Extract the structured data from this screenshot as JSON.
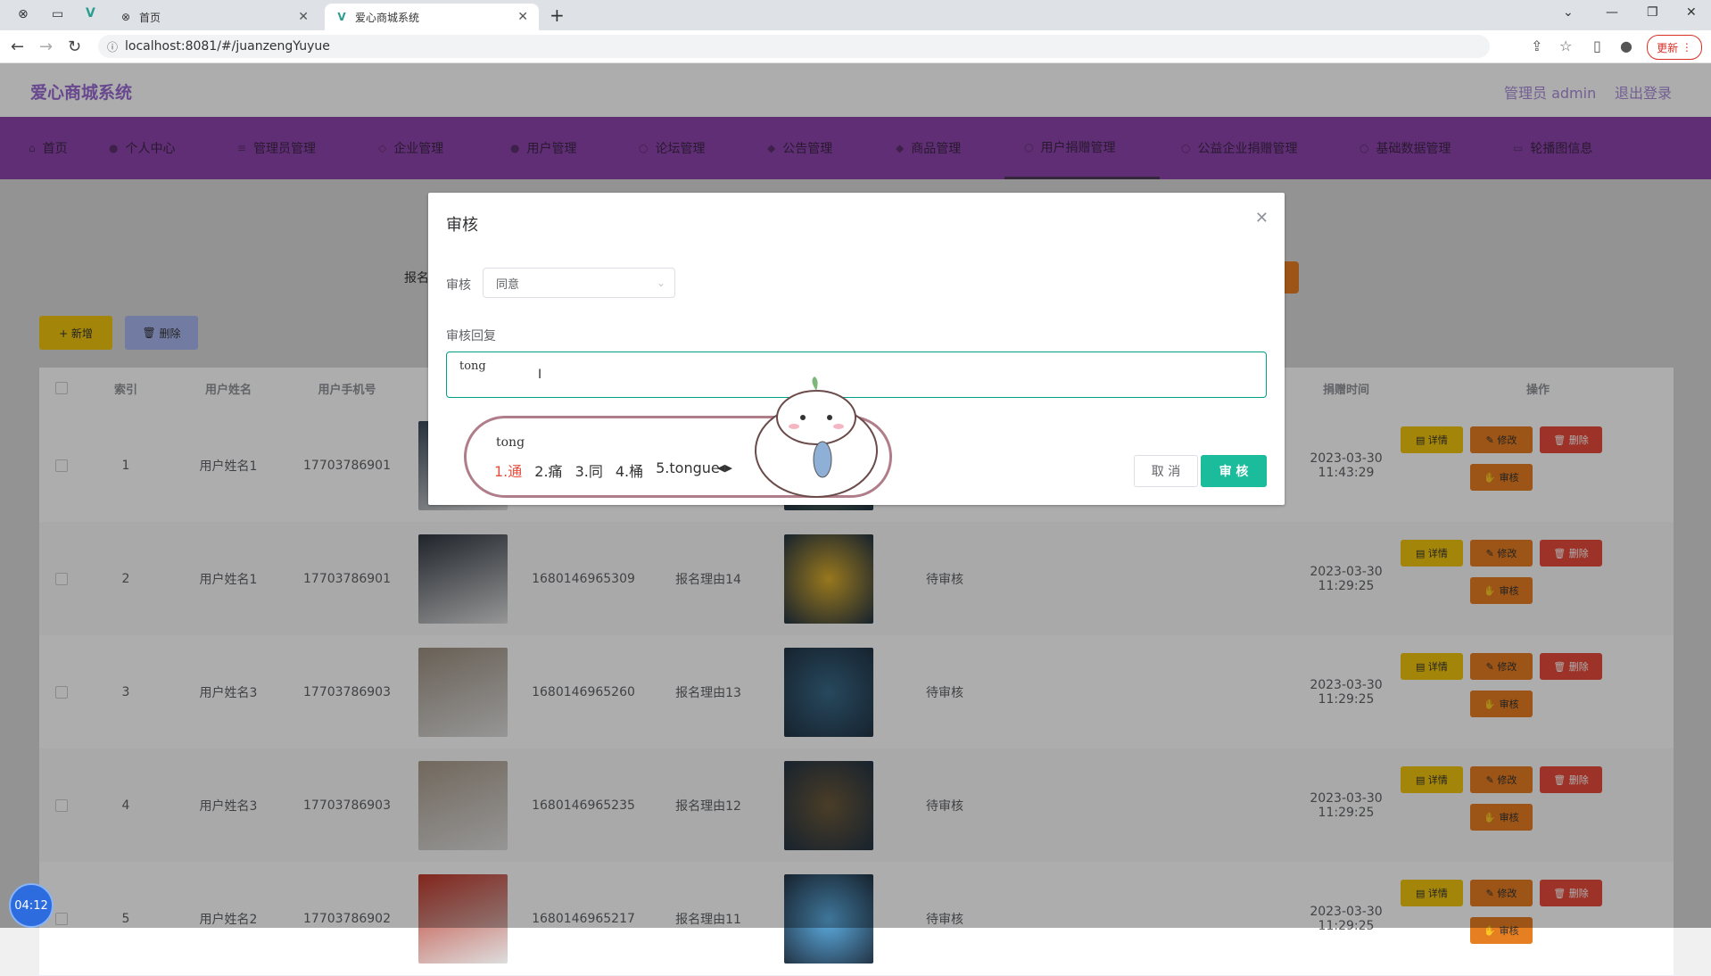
{
  "browser": {
    "tabs": [
      {
        "title": "首页",
        "active": false
      },
      {
        "title": "爱心商城系统",
        "active": true
      }
    ],
    "url": "localhost:8081/#/juanzengYuyue",
    "update_label": "更新"
  },
  "app": {
    "title": "爱心商城系统",
    "admin_label": "管理员 admin",
    "logout_label": "退出登录",
    "nav": [
      "首页",
      "个人中心",
      "管理员管理",
      "企业管理",
      "用户管理",
      "论坛管理",
      "公告管理",
      "商品管理",
      "用户捐赠管理",
      "公益企业捐赠管理",
      "基础数据管理",
      "轮播图信息"
    ],
    "nav_active": "用户捐赠管理"
  },
  "toolbar": {
    "search_label_partial": "报名",
    "add_label": "+ 新增",
    "delete_label": "删除"
  },
  "table": {
    "headers": [
      "索引",
      "用户姓名",
      "用户手机号",
      "捐赠时间",
      "操作"
    ],
    "rows": [
      {
        "index": "1",
        "name": "用户姓名1",
        "phone": "17703786901",
        "order": "",
        "reason": "",
        "status": "",
        "time": "2023-03-30 11:43:29"
      },
      {
        "index": "2",
        "name": "用户姓名1",
        "phone": "17703786901",
        "order": "1680146965309",
        "reason": "报名理由14",
        "status": "待审核",
        "time": "2023-03-30 11:29:25"
      },
      {
        "index": "3",
        "name": "用户姓名3",
        "phone": "17703786903",
        "order": "1680146965260",
        "reason": "报名理由13",
        "status": "待审核",
        "time": "2023-03-30 11:29:25"
      },
      {
        "index": "4",
        "name": "用户姓名3",
        "phone": "17703786903",
        "order": "1680146965235",
        "reason": "报名理由12",
        "status": "待审核",
        "time": "2023-03-30 11:29:25"
      },
      {
        "index": "5",
        "name": "用户姓名2",
        "phone": "17703786902",
        "order": "1680146965217",
        "reason": "报名理由11",
        "status": "待审核",
        "time": "2023-03-30 11:29:25"
      }
    ],
    "actions": {
      "detail": "详情",
      "edit": "修改",
      "remove": "删除",
      "audit": "审核"
    }
  },
  "dialog": {
    "title": "审核",
    "audit_label": "审核",
    "audit_value": "同意",
    "reply_label": "审核回复",
    "reply_value": "tong",
    "cancel_label": "取 消",
    "confirm_label": "审 核"
  },
  "ime": {
    "input": "tong",
    "candidates": [
      "1.通",
      "2.痛",
      "3.同",
      "4.桶",
      "5.tongue"
    ]
  },
  "clock": "04:12"
}
